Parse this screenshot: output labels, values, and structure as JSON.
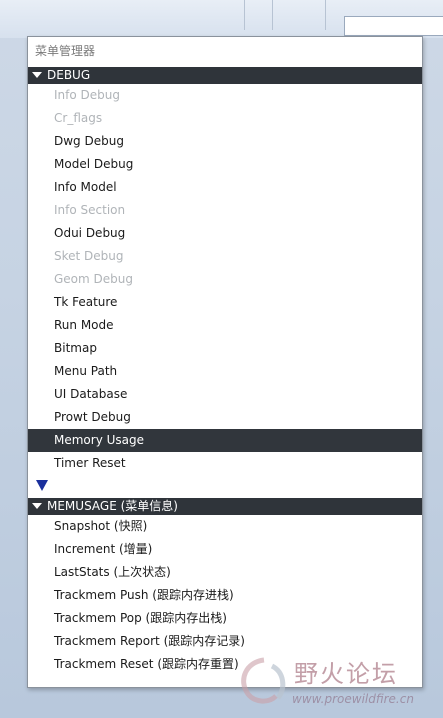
{
  "menu": {
    "title": "菜单管理器",
    "sections": {
      "debug": {
        "label": "DEBUG",
        "items": [
          {
            "label": "Info Debug",
            "enabled": false
          },
          {
            "label": "Cr_flags",
            "enabled": false
          },
          {
            "label": "Dwg Debug",
            "enabled": true
          },
          {
            "label": "Model Debug",
            "enabled": true
          },
          {
            "label": "Info Model",
            "enabled": true
          },
          {
            "label": "Info Section",
            "enabled": false
          },
          {
            "label": "Odui Debug",
            "enabled": true
          },
          {
            "label": "Sket Debug",
            "enabled": false
          },
          {
            "label": "Geom Debug",
            "enabled": false
          },
          {
            "label": "Tk Feature",
            "enabled": true
          },
          {
            "label": "Run Mode",
            "enabled": true
          },
          {
            "label": "Bitmap",
            "enabled": true
          },
          {
            "label": "Menu Path",
            "enabled": true
          },
          {
            "label": "UI Database",
            "enabled": true
          },
          {
            "label": "Prowt Debug",
            "enabled": true
          },
          {
            "label": "Memory Usage",
            "enabled": true,
            "highlighted": true
          },
          {
            "label": "Timer Reset",
            "enabled": true
          }
        ]
      },
      "memusage": {
        "label": "MEMUSAGE (菜单信息)",
        "items": [
          {
            "label": "Snapshot (快照)"
          },
          {
            "label": "Increment (增量)"
          },
          {
            "label": "LastStats (上次状态)"
          },
          {
            "label": "Trackmem Push (跟踪内存进栈)"
          },
          {
            "label": "Trackmem Pop (跟踪内存出栈)"
          },
          {
            "label": "Trackmem Report (跟踪内存记录)"
          },
          {
            "label": "Trackmem Reset (跟踪内存重置)"
          }
        ]
      }
    }
  },
  "watermark": {
    "text": "野火论坛",
    "url": "www.proewildfire.cn"
  },
  "colors": {
    "section_header": "#2f343a",
    "highlight": "#31363c",
    "disabled_text": "#b0b4b8",
    "scroll_arrow": "#1a2f9c"
  }
}
